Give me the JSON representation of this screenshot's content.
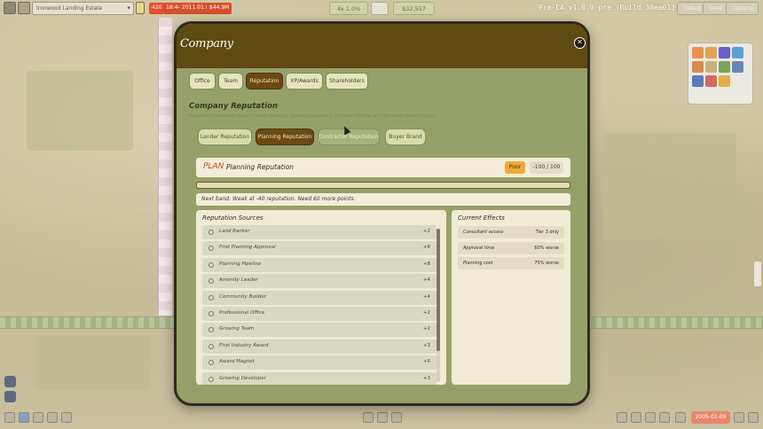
{
  "topbar": {
    "project_select": "Ironwood Landing Estate",
    "stats": [
      {
        "text": "420",
        "color": "#e3522f"
      },
      {
        "text": "18:44",
        "color": "#d94e2c"
      },
      {
        "text": "2011.01.08",
        "color": "#d94e2c"
      },
      {
        "text": "$44.9M",
        "color": "#d94e2c"
      }
    ],
    "center_left_label": "4x 1.0%",
    "center_right_label": "$32,557",
    "version": "Pre-EA v1.0.0-pre (Build 38ea613-01)",
    "menu_buttons": [
      "Debug",
      "Save",
      "Options"
    ]
  },
  "modal": {
    "title": "Company",
    "close_icon": "close-icon",
    "tabs": [
      {
        "label": "Office",
        "active": false
      },
      {
        "label": "Team",
        "active": false
      },
      {
        "label": "Reputation",
        "active": true
      },
      {
        "label": "XP/Awards",
        "active": false
      },
      {
        "label": "Shareholders",
        "active": false
      }
    ],
    "section_title": "Company Reputation",
    "section_description": "Reputation channels shape market standing, planning approvals, contract effects, and the wider brand bought.",
    "subtabs": [
      {
        "label": "Lender Reputation",
        "state": "normal"
      },
      {
        "label": "Planning Reputation",
        "state": "active"
      },
      {
        "label": "Contractor Reputation",
        "state": "hover"
      },
      {
        "label": "Buyer Brand",
        "state": "normal"
      }
    ],
    "reputation": {
      "code": "PLAN",
      "name": "Planning Reputation",
      "badge": "Poor",
      "score": "-100 / 100",
      "progress": 0.0,
      "note": "Next band: Weak at -40 reputation. Need 60 more points."
    },
    "sources_title": "Reputation Sources",
    "sources": [
      {
        "name": "Land Banker",
        "value": "+2"
      },
      {
        "name": "First Planning Approval",
        "value": "+6"
      },
      {
        "name": "Planning Pipeline",
        "value": "+8"
      },
      {
        "name": "Amenity Leader",
        "value": "+4"
      },
      {
        "name": "Community Builder",
        "value": "+4"
      },
      {
        "name": "Professional Office",
        "value": "+2"
      },
      {
        "name": "Growing Team",
        "value": "+2"
      },
      {
        "name": "First Industry Award",
        "value": "+3"
      },
      {
        "name": "Award Magnet",
        "value": "+6"
      },
      {
        "name": "Growing Developer",
        "value": "+3"
      }
    ],
    "effects_title": "Current Effects",
    "effects": [
      {
        "name": "Consultant access",
        "value": "Tier 3 only"
      },
      {
        "name": "Approval time",
        "value": "60% worse"
      },
      {
        "name": "Planning cost",
        "value": "75% worse"
      }
    ]
  },
  "bottombar": {
    "date": "2005-01-09"
  },
  "colors": {
    "modal_bg": "#96a169",
    "header_bg": "#5f4a12",
    "active_tab": "#6b4a12",
    "plan_code": "#c2541a",
    "badge": "#f0a93a"
  }
}
